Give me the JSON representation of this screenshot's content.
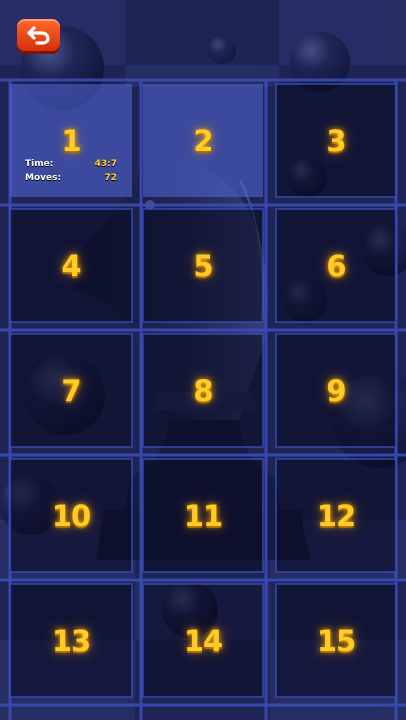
{
  "stats": {
    "time_label": "Time:",
    "time_value": "43:7",
    "moves_label": "Moves:",
    "moves_value": "72"
  },
  "tiles": [
    {
      "number": "1",
      "style": "light"
    },
    {
      "number": "2",
      "style": "light"
    },
    {
      "number": "3",
      "style": "dark"
    },
    {
      "number": "4",
      "style": "dark"
    },
    {
      "number": "5",
      "style": "dark"
    },
    {
      "number": "6",
      "style": "dark"
    },
    {
      "number": "7",
      "style": "dark"
    },
    {
      "number": "8",
      "style": "dark"
    },
    {
      "number": "9",
      "style": "dark"
    },
    {
      "number": "10",
      "style": "dark"
    },
    {
      "number": "11",
      "style": "dark"
    },
    {
      "number": "12",
      "style": "dark"
    },
    {
      "number": "13",
      "style": "dark"
    },
    {
      "number": "14",
      "style": "dark"
    },
    {
      "number": "15",
      "style": "dark"
    }
  ],
  "empty_slot": 16,
  "icons": {
    "back": "back-arrow-icon",
    "background": "chess-knight-icon"
  },
  "colors": {
    "tile_number": "#ffcb24",
    "stat_value": "#ffd12e",
    "back_button": "#e8420f",
    "grid_line": "#3c4ebe"
  }
}
